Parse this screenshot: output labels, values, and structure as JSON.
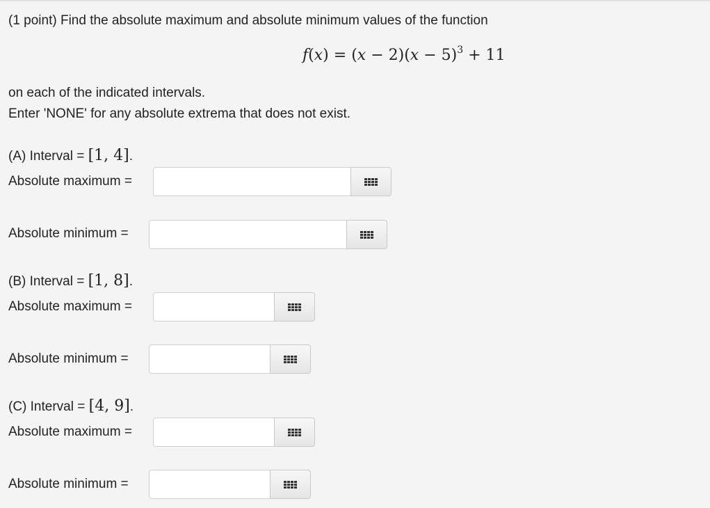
{
  "intro": "(1 point) Find the absolute maximum and absolute minimum values of the function",
  "formula": {
    "lhs_name": "f",
    "lhs_var": "x",
    "equals": "=",
    "f1_open": "(",
    "f1_var": "x",
    "f1_rest": " − 2)(",
    "f2_var": "x",
    "f2_rest": " − 5)",
    "exponent": "3",
    "tail": " + 11"
  },
  "line1": "on each of the indicated intervals.",
  "line2": "Enter 'NONE' for any absolute extrema that does not exist.",
  "parts": [
    {
      "label": "(A) Interval = ",
      "interval": "[1, 4]",
      "max_label": "Absolute maximum =",
      "max_value": "",
      "min_label": "Absolute minimum =",
      "min_value": ""
    },
    {
      "label": "(B) Interval = ",
      "interval": "[1, 8]",
      "max_label": "Absolute maximum =",
      "max_value": "",
      "min_label": "Absolute minimum =",
      "min_value": ""
    },
    {
      "label": "(C) Interval = ",
      "interval": "[4, 9]",
      "max_label": "Absolute maximum =",
      "max_value": "",
      "min_label": "Absolute minimum =",
      "min_value": ""
    }
  ],
  "period": ".",
  "palette_icon": "grid-keypad-icon"
}
